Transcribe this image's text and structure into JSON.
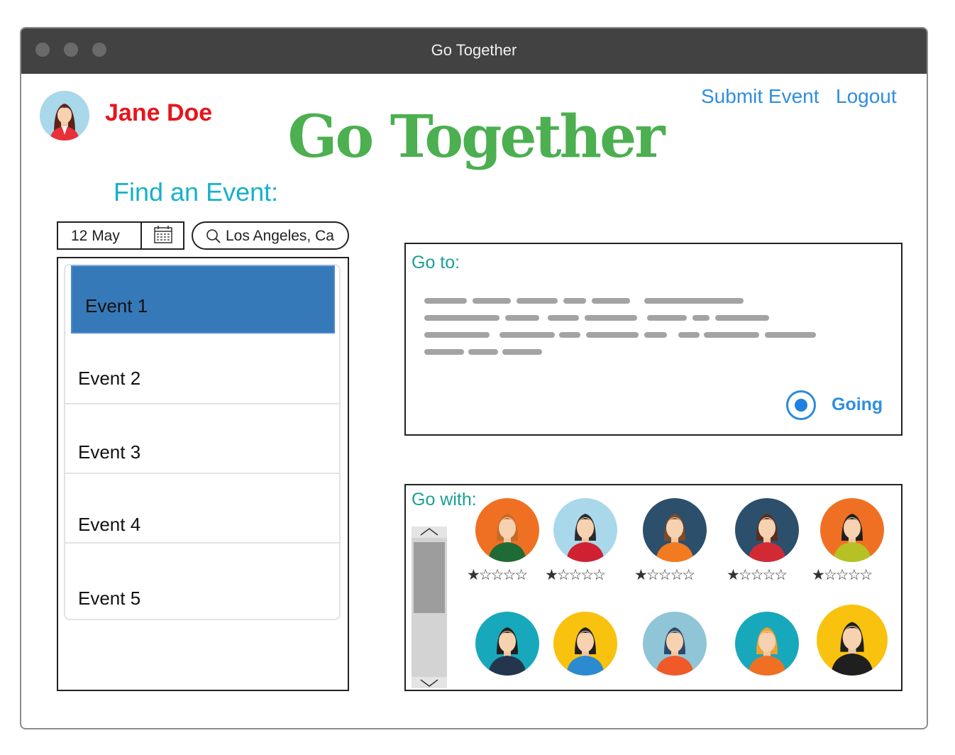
{
  "window": {
    "title": "Go Together"
  },
  "user": {
    "name": "Jane Doe"
  },
  "nav": {
    "submit_event": "Submit Event",
    "logout": "Logout"
  },
  "logo": "Go Together",
  "find_heading": "Find an Event:",
  "date_field": {
    "value": "12 May"
  },
  "location_search": {
    "value": "Los Angeles, Ca"
  },
  "events": [
    {
      "label": "Event 1",
      "selected": true
    },
    {
      "label": "Event 2",
      "selected": false
    },
    {
      "label": "Event 3",
      "selected": false
    },
    {
      "label": "Event 4",
      "selected": false
    },
    {
      "label": "Event 5",
      "selected": false
    }
  ],
  "go_to": {
    "title": "Go to:",
    "going_label": "Going",
    "going_selected": true
  },
  "go_with": {
    "title": "Go with:",
    "people": [
      {
        "bg": "#f07023",
        "shirt": "#1f6b35",
        "hair": "#c46a2a",
        "rating": 1
      },
      {
        "bg": "#a8d8ea",
        "shirt": "#cf2132",
        "hair": "#2b2b2b",
        "rating": 1
      },
      {
        "bg": "#2c4f6b",
        "shirt": "#f27b20",
        "hair": "#7b4b2a",
        "rating": 1
      },
      {
        "bg": "#2c4f6b",
        "shirt": "#d12a35",
        "hair": "#5b2d1e",
        "rating": 1
      },
      {
        "bg": "#f07023",
        "shirt": "#b6c224",
        "hair": "#1f1f1f",
        "rating": 1
      },
      {
        "bg": "#18a8bb",
        "shirt": "#24364d",
        "hair": "#1f1f1f"
      },
      {
        "bg": "#f8c20f",
        "shirt": "#2b8ad0",
        "hair": "#1f1f1f"
      },
      {
        "bg": "#8fc5d6",
        "shirt": "#f05a28",
        "hair": "#2b4a6b"
      },
      {
        "bg": "#18a8bb",
        "shirt": "#f07023",
        "hair": "#f0a030"
      },
      {
        "bg": "#f8c20f",
        "shirt": "#1f1f1f",
        "hair": "#1f1f1f"
      }
    ]
  },
  "colors": {
    "accent_link": "#2f8ee0",
    "logo": "#4caf50",
    "user_name": "#e8151b",
    "selection": "#3679b8"
  }
}
